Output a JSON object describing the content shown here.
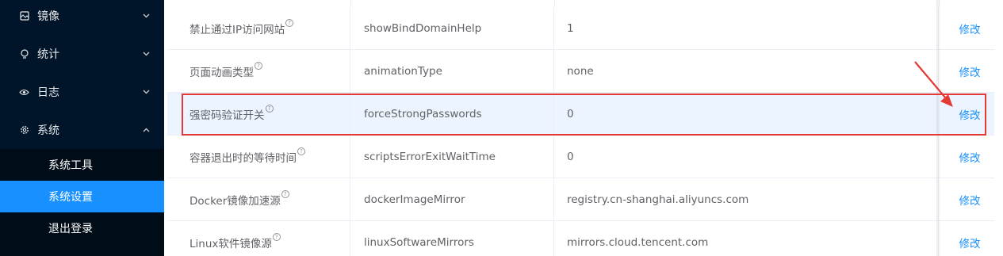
{
  "sidebar": {
    "menu": [
      {
        "label": "镜像",
        "icon": "image-icon",
        "chevron": "down"
      },
      {
        "label": "统计",
        "icon": "bulb-icon",
        "chevron": "down"
      },
      {
        "label": "日志",
        "icon": "eye-icon",
        "chevron": "down"
      },
      {
        "label": "系统",
        "icon": "gear-icon",
        "chevron": "up"
      }
    ],
    "submenu": [
      {
        "label": "系统工具",
        "active": false
      },
      {
        "label": "系统设置",
        "active": true
      },
      {
        "label": "退出登录",
        "active": false
      }
    ],
    "colors": {
      "background": "#001529",
      "submenu_background": "#000c17",
      "active": "#1890ff"
    }
  },
  "table": {
    "rows": [
      {
        "name": "禁止通过IP访问网站",
        "key": "showBindDomainHelp",
        "value": "1",
        "action": "修改"
      },
      {
        "name": "页面动画类型",
        "key": "animationType",
        "value": "none",
        "action": "修改"
      },
      {
        "name": "强密码验证开关",
        "key": "forceStrongPasswords",
        "value": "0",
        "action": "修改",
        "highlighted": true
      },
      {
        "name": "容器退出时的等待时间",
        "key": "scriptsErrorExitWaitTime",
        "value": "0",
        "action": "修改"
      },
      {
        "name": "Docker镜像加速源",
        "key": "dockerImageMirror",
        "value": "registry.cn-shanghai.aliyuncs.com",
        "action": "修改"
      },
      {
        "name": "Linux软件镜像源",
        "key": "linuxSoftwareMirrors",
        "value": "mirrors.cloud.tencent.com",
        "action": "修改"
      }
    ],
    "help_glyph": "?",
    "colors": {
      "link": "#1890ff",
      "highlight_row": "#ecf5ff",
      "annotation": "#e53935"
    }
  }
}
